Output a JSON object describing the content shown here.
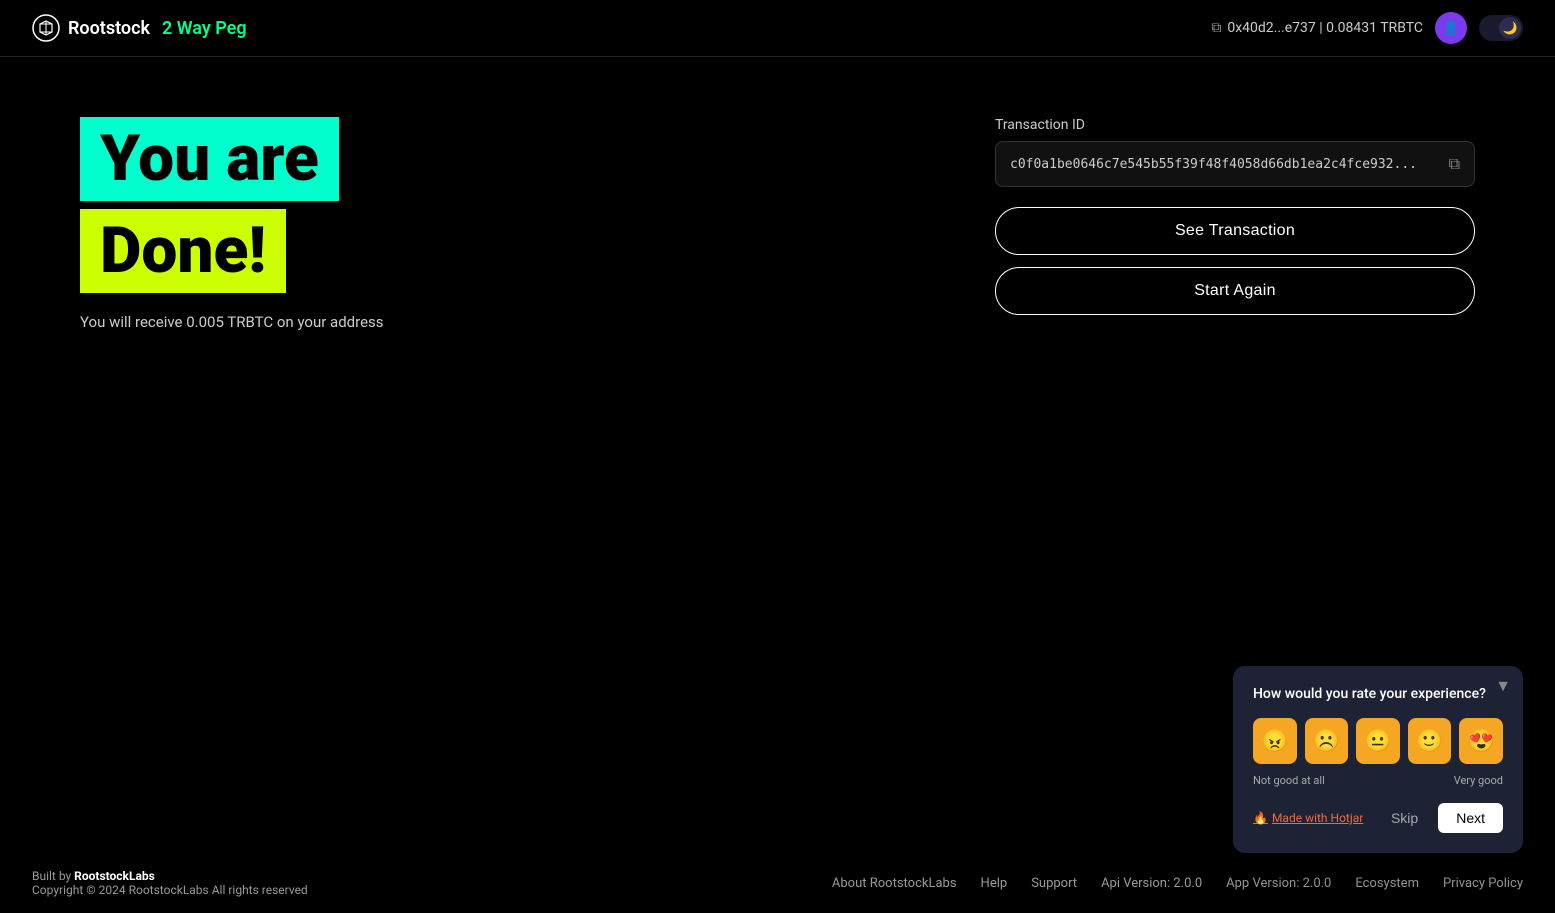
{
  "header": {
    "logo_text": "Rootstock",
    "nav_label": "2 Way Peg",
    "wallet_address": "0x40d2...e737 | 0.08431 TRBTC"
  },
  "main": {
    "headline_line1": "You are",
    "headline_line2": "Done!",
    "subtitle": "You will receive 0.005 TRBTC on your address",
    "transaction_id_label": "Transaction ID",
    "transaction_id_value": "c0f0a1be0646c7e545b55f39f48f4058d66db1ea2c4fce932...",
    "see_transaction_btn": "See Transaction",
    "start_again_btn": "Start Again"
  },
  "footer": {
    "built_by": "Built by",
    "company": "RootstockLabs",
    "copyright": "Copyright © 2024 RootstockLabs All rights reserved",
    "links": [
      "About RootstockLabs",
      "Help",
      "Support",
      "Api Version: 2.0.0",
      "App Version: 2.0.0",
      "Ecosystem",
      "Privacy Policy"
    ]
  },
  "rating_widget": {
    "question": "How would you rate your experience?",
    "emojis": [
      "😠",
      "☹️",
      "😐",
      "🙂",
      "😍"
    ],
    "label_left": "Not good at all",
    "label_right": "Very good",
    "hotjar_label": "Made with Hotjar",
    "skip_label": "Skip",
    "next_label": "Next"
  }
}
